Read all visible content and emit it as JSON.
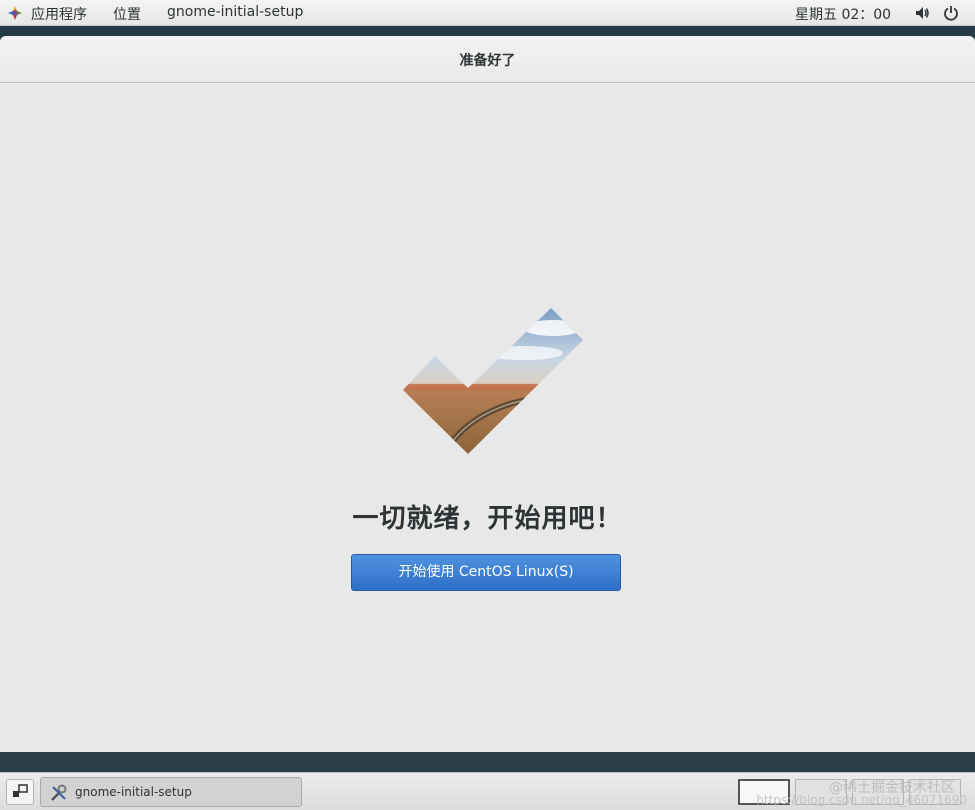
{
  "topbar": {
    "applications_label": "应用程序",
    "places_label": "位置",
    "active_app_label": "gnome-initial-setup",
    "clock": "星期五 02：00"
  },
  "window": {
    "title": "准备好了",
    "headline": "一切就绪，开始用吧！",
    "start_button_label": "开始使用  CentOS Linux(S)"
  },
  "taskbar": {
    "task_label": "gnome-initial-setup",
    "watermark": "@稀土掘金技术社区",
    "watermark_url": "https://blog.csdn.net/qq_46071690"
  },
  "colors": {
    "accent": "#3b7fd4",
    "window_bg": "#e8e8e8"
  }
}
